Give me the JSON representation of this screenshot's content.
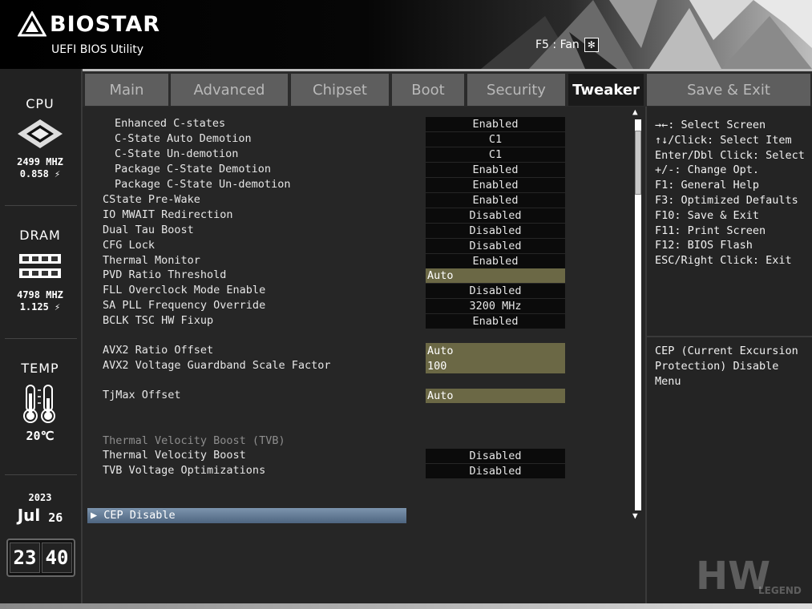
{
  "header": {
    "brand": "BIOSTAR",
    "subtitle": "UEFI BIOS Utility",
    "fan_hint": "F5 : Fan"
  },
  "sidebar": {
    "cpu": {
      "title": "CPU",
      "freq": "2499 MHZ",
      "volt": "0.858 ⚡"
    },
    "dram": {
      "title": "DRAM",
      "freq": "4798 MHZ",
      "volt": "1.125 ⚡"
    },
    "temp": {
      "title": "TEMP",
      "value": "20℃"
    },
    "date": {
      "year": "2023",
      "month": "Jul",
      "day": "26"
    },
    "clock": {
      "hours": "23",
      "minutes": "40"
    }
  },
  "tabs": [
    {
      "label": "Main"
    },
    {
      "label": "Advanced"
    },
    {
      "label": "Chipset"
    },
    {
      "label": "Boot"
    },
    {
      "label": "Security"
    },
    {
      "label": "Tweaker"
    },
    {
      "label": "Save & Exit"
    }
  ],
  "settings": [
    {
      "label": "Enhanced C-states",
      "value": "Enabled"
    },
    {
      "label": "C-State Auto Demotion",
      "value": "C1"
    },
    {
      "label": "C-State Un-demotion",
      "value": "C1"
    },
    {
      "label": "Package C-State Demotion",
      "value": "Enabled"
    },
    {
      "label": "Package C-State Un-demotion",
      "value": "Enabled"
    },
    {
      "label": "CState Pre-Wake",
      "value": "Enabled"
    },
    {
      "label": "IO MWAIT Redirection",
      "value": "Disabled"
    },
    {
      "label": "Dual Tau Boost",
      "value": "Disabled"
    },
    {
      "label": "CFG Lock",
      "value": "Disabled"
    },
    {
      "label": "Thermal Monitor",
      "value": "Enabled"
    },
    {
      "label": "PVD Ratio Threshold",
      "value": "Auto"
    },
    {
      "label": "FLL Overclock Mode Enable",
      "value": "Disabled"
    },
    {
      "label": "SA PLL Frequency Override",
      "value": "3200 MHz"
    },
    {
      "label": "BCLK TSC HW Fixup",
      "value": "Enabled"
    },
    {
      "label": "AVX2 Ratio Offset",
      "value": "Auto"
    },
    {
      "label": "AVX2 Voltage Guardband Scale Factor",
      "value": "100"
    },
    {
      "label": "TjMax Offset",
      "value": "Auto"
    },
    {
      "label": "Thermal Velocity Boost (TVB)"
    },
    {
      "label": "Thermal Velocity Boost",
      "value": "Disabled"
    },
    {
      "label": "TVB Voltage Optimizations",
      "value": "Disabled"
    }
  ],
  "selected_item": "CEP Disable",
  "help": {
    "keys": [
      "→←: Select Screen",
      "↑↓/Click: Select Item",
      "Enter/Dbl Click: Select",
      "+/-: Change Opt.",
      "F1: General Help",
      "F3: Optimized Defaults",
      "F10: Save & Exit",
      "F11: Print Screen",
      "F12: BIOS Flash",
      "ESC/Right Click: Exit"
    ],
    "description": "CEP (Current Excursion Protection) Disable Menu"
  },
  "watermark": {
    "big": "HW",
    "small": "LEGEND"
  },
  "colors": {
    "editable_value_bg": "#6b6845",
    "selected_bg": "#5f7894",
    "active_tab_bg": "#1a1a1a"
  }
}
